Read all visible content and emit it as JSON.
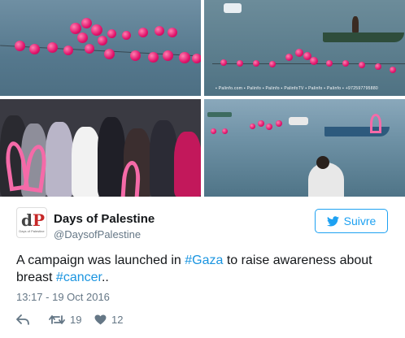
{
  "tweet": {
    "display_name": "Days of Palestine",
    "handle": "@DaysofPalestine",
    "avatar": {
      "mark_d": "d",
      "mark_p": "P",
      "caption": "Days of Palestine"
    },
    "follow_label": "Suivre",
    "text_parts": {
      "before": "A campaign was launched in ",
      "tag1": "#Gaza",
      "middle": " to raise awareness about breast ",
      "tag2": "#cancer",
      "after": ".."
    },
    "timestamp": "13:17 - 19 Oct 2016",
    "retweet_count": "19",
    "like_count": "12"
  },
  "photos": {
    "watermark": "▪ Palinfo.com  ▪ Palinfo  ▪ Palinfo  ▪ PalinfoTV  ▪ Palinfo  ▪ Palinfo  ▪ +972597795880"
  },
  "colors": {
    "accent": "#1da1f2",
    "link": "#1b95e0",
    "buoy": "#e0136b"
  }
}
